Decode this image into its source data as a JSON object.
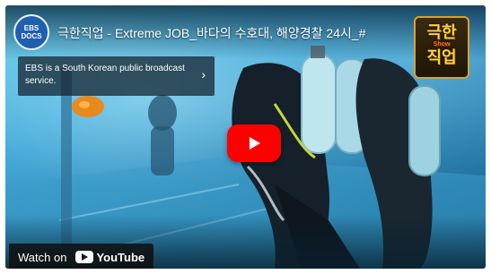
{
  "video": {
    "title": "극한직업 - Extreme JOB_바다의 수호대, 해양경찰 24시_#",
    "play_icon": "play-icon"
  },
  "channel": {
    "logo_line1": "EBS",
    "logo_line2": "DOCS"
  },
  "info_card": {
    "text": "EBS is a South Korean public broadcast service.",
    "arrow": "›"
  },
  "show_badge": {
    "line1": "극한",
    "tag": "Show",
    "line2": "직업"
  },
  "watch_bar": {
    "label": "Watch on",
    "brand": "YouTube"
  },
  "colors": {
    "play_button": "#FF0000",
    "water": "#2A86B8",
    "channel_logo": "#1F5FAE"
  }
}
